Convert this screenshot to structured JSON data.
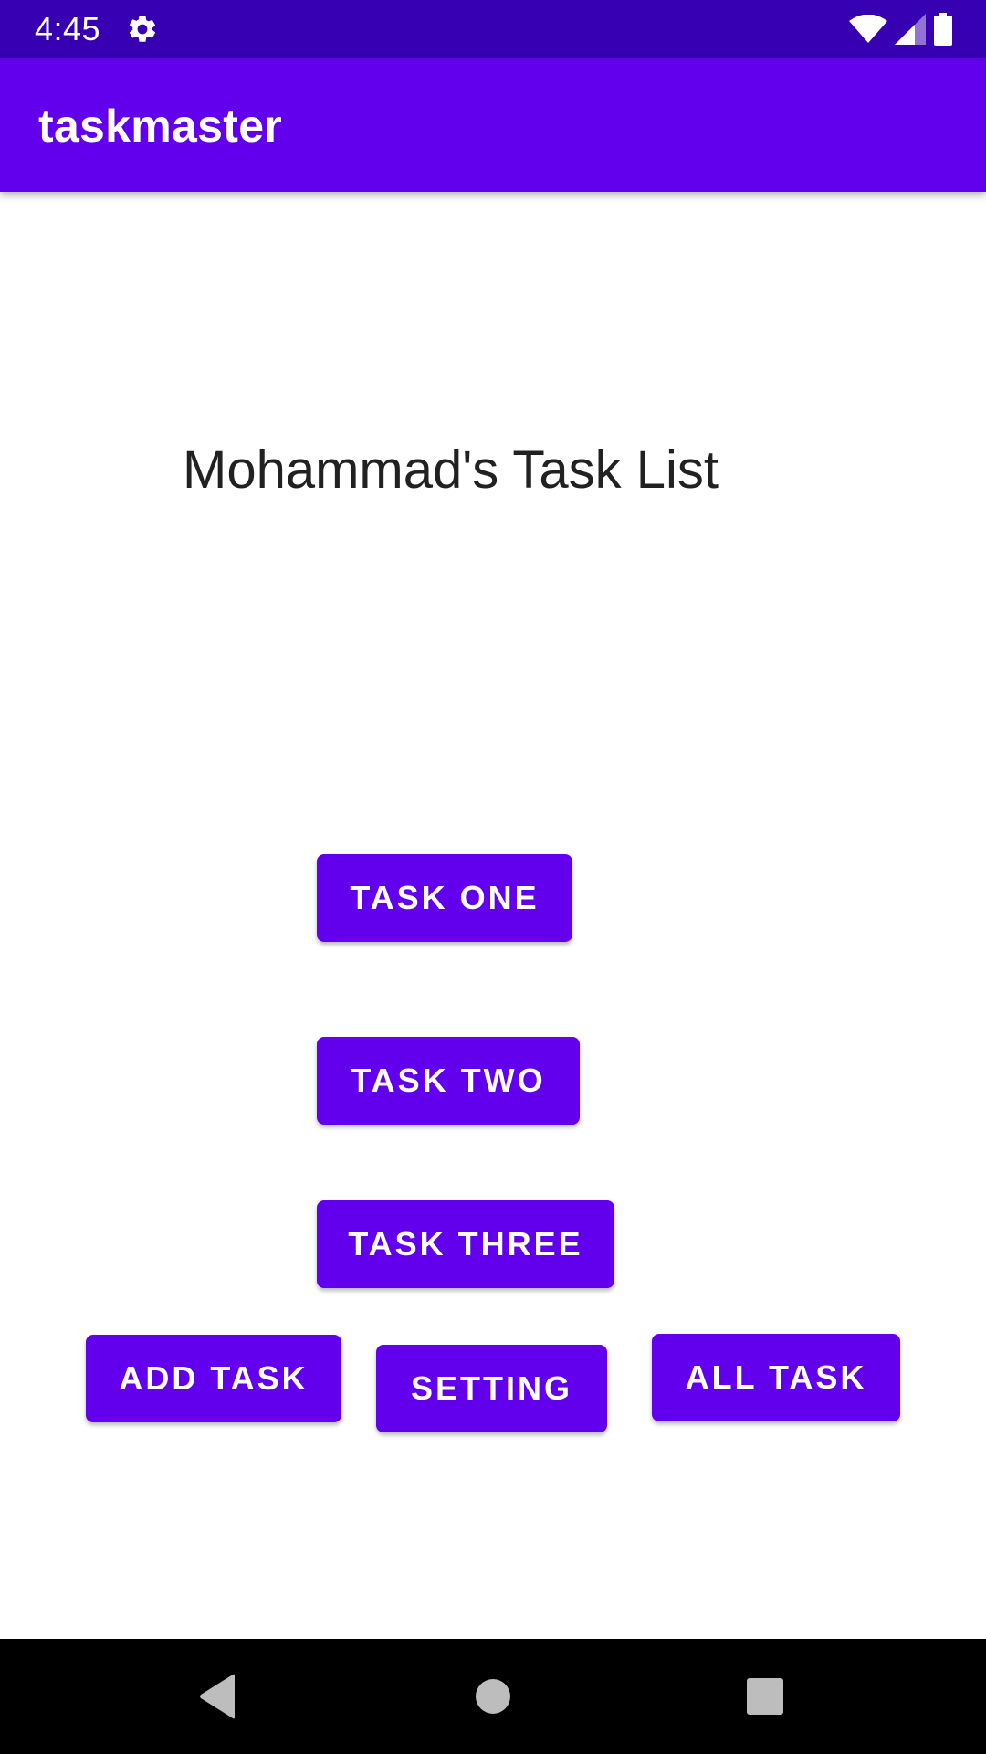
{
  "status_bar": {
    "time": "4:45",
    "icons": [
      "gear-icon",
      "wifi-icon",
      "signal-icon",
      "battery-icon"
    ]
  },
  "app_bar": {
    "title": "taskmaster"
  },
  "main": {
    "heading": "Mohammad's Task List",
    "task_buttons": [
      {
        "label": "TASK ONE"
      },
      {
        "label": "TASK TWO"
      },
      {
        "label": "TASK THREE"
      }
    ],
    "action_buttons": {
      "add_task": "ADD TASK",
      "setting": "SETTING",
      "all_task": "ALL TASK"
    }
  },
  "nav_bar": {
    "icons": [
      "back-icon",
      "home-icon",
      "recents-icon"
    ]
  },
  "colors": {
    "status_bar": "#3700b3",
    "primary": "#6200ee",
    "text": "#212121",
    "nav_bar": "#000000"
  }
}
